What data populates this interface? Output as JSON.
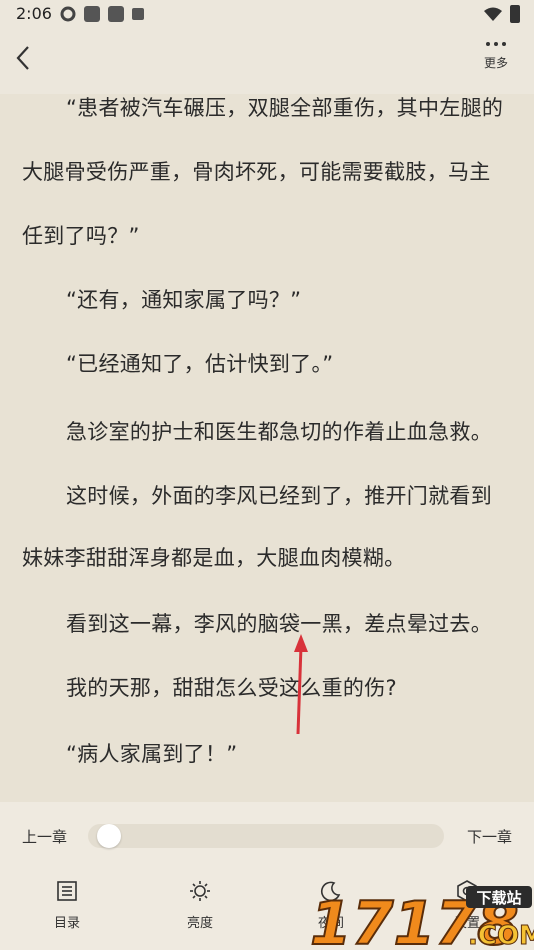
{
  "status": {
    "time": "2:06"
  },
  "header": {
    "more_label": "更多"
  },
  "content": {
    "paragraphs": [
      "“患者被汽车碾压，双腿全部重伤，其中左腿的",
      "大腿骨受伤严重，骨肉坏死，可能需要截肢，马主",
      "任到了吗？”",
      "“还有，通知家属了吗？”",
      "“已经通知了，估计快到了。”",
      "急诊室的护士和医生都急切的作着止血急救。",
      "这时候，外面的李风已经到了，推开门就看到",
      "妹妹李甜甜浑身都是血，大腿血肉模糊。",
      "看到这一幕，李风的脑袋一黑，差点晕过去。",
      "我的天那，甜甜怎么受这么重的伤?",
      "“病人家属到了！”"
    ]
  },
  "bottom": {
    "prev_chapter": "上一章",
    "next_chapter": "下一章",
    "progress": 0.02,
    "tools": [
      {
        "label": "目录",
        "icon": "list-icon"
      },
      {
        "label": "亮度",
        "icon": "brightness-icon"
      },
      {
        "label": "夜间",
        "icon": "night-mode-icon"
      },
      {
        "label": "设置",
        "icon": "settings-icon"
      }
    ]
  },
  "watermark": {
    "text": "17178",
    "badge": "下载站",
    "domain": ".COM"
  }
}
